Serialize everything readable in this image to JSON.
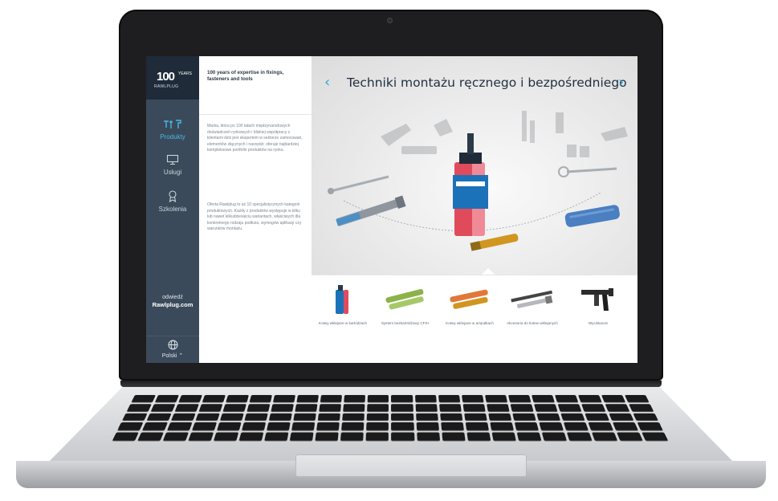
{
  "sidebar": {
    "logo": {
      "number": "100",
      "years": "YEARS",
      "brand": "RAWLPLUG"
    },
    "items": [
      {
        "label": "Produkty",
        "icon": "tools-icon",
        "active": true
      },
      {
        "label": "Usługi",
        "icon": "monitor-icon",
        "active": false
      },
      {
        "label": "Szkolenia",
        "icon": "certificate-icon",
        "active": false
      }
    ],
    "visit": {
      "line1": "odwiedź",
      "line2": "Rawlplug.com"
    },
    "language": {
      "label": "Polski ⌃",
      "icon": "globe-icon"
    }
  },
  "intro": {
    "heading": "100 years of expertise in fixings, fasteners and tools",
    "para1": "Marka, która po 100 latach międzynarodowych doświadczeń rynkowych i bliskiej współpracy z klientami dziś jest ekspertem w sektorze zamocowań, elementów złącznych i narzędzi; oferuje najbardziej kompleksowe portfolio produktów na rynku.",
    "para2": "Oferta Rawlplug to aż 10 specjalistycznych kategorii produktowych. Każdy z produktów występuje w kilku lub nawet kilkudziesięciu wariantach, właściwych dla konkretnego rodzaju podłoża, wymogów aplikacji czy warunków montażu."
  },
  "hero": {
    "title": "Techniki montażu ręcznego i bezpośredniego",
    "prev": "‹",
    "next": "›"
  },
  "products": [
    {
      "label": "Kotwy wklejane w kartridżach"
    },
    {
      "label": "System bezkartridżowy CFS+"
    },
    {
      "label": "Kotwy wklejane w ampułkach"
    },
    {
      "label": "Akcesoria do kotew wklejanych"
    },
    {
      "label": "Wyciskacze"
    }
  ],
  "colors": {
    "accent": "#2aa7d6",
    "sidebar": "#3b4a5a",
    "sidebar_dark": "#1f2b38",
    "title": "#1f2f3e"
  }
}
